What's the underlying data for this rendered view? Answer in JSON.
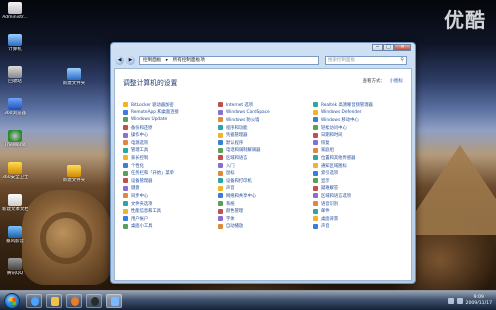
{
  "watermark": "优酷",
  "desktop_icons": [
    {
      "label": "Administr...",
      "icon": "user-folder-icon"
    },
    {
      "label": "计算机",
      "icon": "computer-icon"
    },
    {
      "label": "回收站",
      "icon": "recycle-bin-icon"
    },
    {
      "label": "360浏览器",
      "icon": "browser-icon"
    },
    {
      "label": "TheWorld",
      "icon": "theworld-icon"
    },
    {
      "label": "360安全卫士",
      "icon": "shield-icon"
    },
    {
      "label": "新建文本文档",
      "icon": "text-file-icon"
    },
    {
      "label": "暴风影音",
      "icon": "player-icon"
    },
    {
      "label": "腾讯QQ",
      "icon": "qq-icon"
    }
  ],
  "desktop_icon_2": {
    "label": "新建文件夹",
    "icon": "folder-icon"
  },
  "desktop_icon_3": {
    "label": "新建文件夹",
    "icon": "folder-icon"
  },
  "window": {
    "breadcrumb": [
      "控制面板",
      "所有控制面板项"
    ],
    "search_placeholder": "搜索控制面板",
    "title": "调整计算机的设置",
    "view_by_label": "查看方式：",
    "view_by_value": "小图标",
    "buttons": {
      "minimize": "─",
      "maximize": "□",
      "close": "✕"
    }
  },
  "control_panel_items": {
    "col1": [
      "BitLocker 驱动器加密",
      "RemoteApp 和桌面连接",
      "Windows Update",
      "备份和还原",
      "操作中心",
      "电源选项",
      "管理工具",
      "家长控制",
      "个性化",
      "任务栏和「开始」菜单",
      "设备管理器",
      "键盘",
      "同步中心",
      "文件夹选项",
      "性能信息和工具",
      "用户帐户",
      "桌面小工具"
    ],
    "col2": [
      "Internet 选项",
      "Windows CardSpace",
      "Windows 防火墙",
      "程序和功能",
      "凭据管理器",
      "默认程序",
      "电话和调制解调器",
      "区域和语言",
      "入门",
      "鼠标",
      "设备和打印机",
      "声音",
      "网络和共享中心",
      "系统",
      "颜色管理",
      "字体",
      "自动播放"
    ],
    "col3": [
      "Realtek 高清晰音频管理器",
      "Windows Defender",
      "Windows 移动中心",
      "轻松访问中心",
      "日期和时间",
      "恢复",
      "家庭组",
      "位置和其他传感器",
      "通知区域图标",
      "索引选项",
      "显示",
      "疑难解答",
      "区域和语言选项",
      "语音识别",
      "邮件",
      "桌面背景",
      "声音"
    ]
  },
  "taskbar": {
    "apps": [
      {
        "icon": "ie-icon"
      },
      {
        "icon": "explorer-icon"
      },
      {
        "icon": "media-player-icon"
      },
      {
        "icon": "qq-icon"
      },
      {
        "icon": "control-panel-icon"
      }
    ],
    "time": "9:09",
    "date": "2009/11/17"
  },
  "colors": {
    "link": "#1e4a9a",
    "title": "#1e3a6e",
    "accent": "#2f6fc0"
  }
}
